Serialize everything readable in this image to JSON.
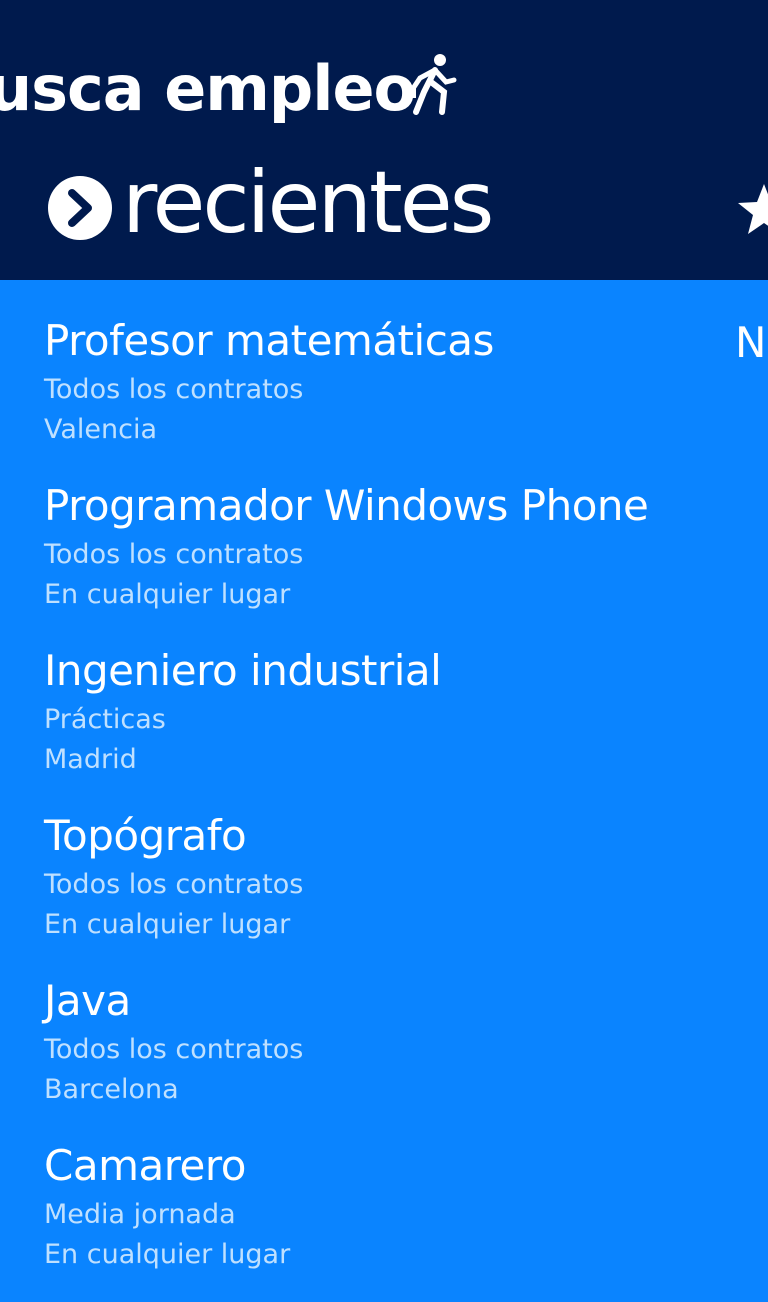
{
  "header": {
    "app_title": "usca empleo",
    "pivot_title": "recientes",
    "next_pivot_peek": "N"
  },
  "icons": {
    "app_icon": "walking-person-icon",
    "pivot_icon": "chevron-right-circle-icon",
    "next_pivot_icon": "star-icon"
  },
  "searches": [
    {
      "title": "Profesor matemáticas",
      "contract": "Todos los contratos",
      "location": "Valencia"
    },
    {
      "title": "Programador Windows Phone",
      "contract": "Todos los contratos",
      "location": "En cualquier lugar"
    },
    {
      "title": "Ingeniero industrial",
      "contract": "Prácticas",
      "location": "Madrid"
    },
    {
      "title": "Topógrafo",
      "contract": "Todos los contratos",
      "location": "En cualquier lugar"
    },
    {
      "title": "Java",
      "contract": "Todos los contratos",
      "location": "Barcelona"
    },
    {
      "title": "Camarero",
      "contract": "Media jornada",
      "location": "En cualquier lugar"
    }
  ],
  "colors": {
    "header_background": "#001a4d",
    "content_background": "#0a84ff",
    "subtitle_text": "#bfe0ff"
  }
}
